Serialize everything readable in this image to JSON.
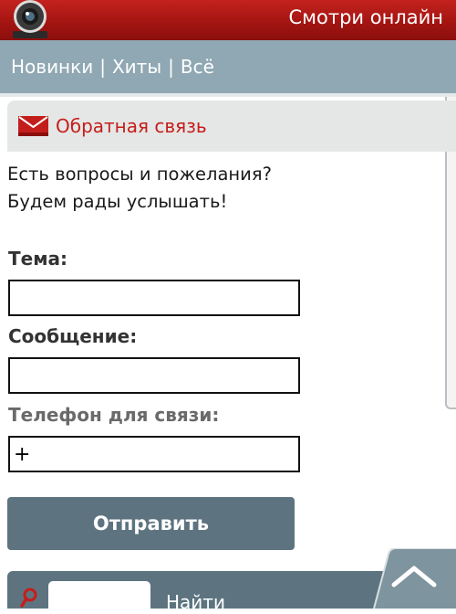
{
  "header": {
    "title": "Смотри онлайн",
    "logo_icon": "webcam-icon"
  },
  "nav": {
    "items": [
      "Новинки",
      "Хиты",
      "Всё"
    ],
    "separator": "|"
  },
  "section": {
    "title": "Обратная связь",
    "icon": "mail-icon",
    "icon_color": "#c41e1c"
  },
  "intro": {
    "line1": "Есть вопросы и пожелания?",
    "line2": "Будем рады услышать!"
  },
  "form": {
    "subject_label": "Тема:",
    "subject_value": "",
    "message_label": "Сообщение:",
    "message_value": "",
    "phone_label": "Телефон для связи:",
    "phone_value": "+",
    "submit_label": "Отправить"
  },
  "search": {
    "button_label": "Найти",
    "icon": "search-icon"
  },
  "colors": {
    "header": "#a41512",
    "nav": "#8fa8b3",
    "button": "#5d7480",
    "accent": "#c41e1c"
  }
}
